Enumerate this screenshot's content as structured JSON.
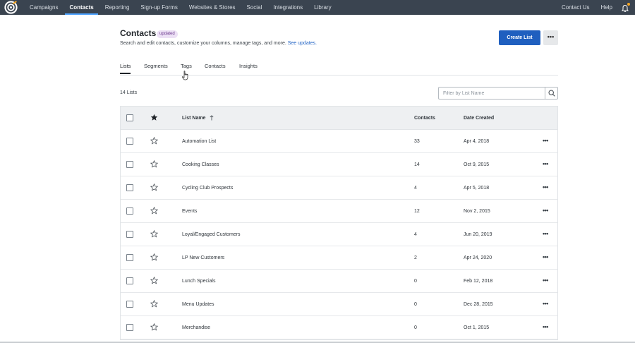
{
  "nav": {
    "items": [
      {
        "label": "Campaigns",
        "active": false
      },
      {
        "label": "Contacts",
        "active": true
      },
      {
        "label": "Reporting",
        "active": false
      },
      {
        "label": "Sign-up Forms",
        "active": false
      },
      {
        "label": "Websites & Stores",
        "active": false
      },
      {
        "label": "Social",
        "active": false
      },
      {
        "label": "Integrations",
        "active": false
      },
      {
        "label": "Library",
        "active": false
      }
    ],
    "contact_us": "Contact Us",
    "help": "Help",
    "notification_icon": "bell-icon",
    "brand_color": "#3a4450",
    "accent_color": "#f5a623"
  },
  "header": {
    "title": "Contacts",
    "badge": "updated",
    "subtitle": "Search and edit contacts, customize your columns, manage tags, and more.",
    "subtitle_link": "See updates.",
    "create_button": "Create List",
    "more_button": "•••",
    "primary_color": "#1f5fbf"
  },
  "tabs": [
    {
      "label": "Lists",
      "active": true
    },
    {
      "label": "Segments",
      "active": false
    },
    {
      "label": "Tags",
      "active": false
    },
    {
      "label": "Contacts",
      "active": false
    },
    {
      "label": "Insights",
      "active": false
    }
  ],
  "list_count": "14 Lists",
  "filter": {
    "placeholder": "Filter by List Name",
    "icon": "search-icon"
  },
  "table": {
    "columns": {
      "name": "List Name",
      "contacts": "Contacts",
      "date": "Date Created"
    },
    "rows": [
      {
        "name": "Automation List",
        "contacts": "33",
        "date": "Apr 4, 2018"
      },
      {
        "name": "Cooking Classes",
        "contacts": "14",
        "date": "Oct 9, 2015"
      },
      {
        "name": "Cycling Club Prospects",
        "contacts": "4",
        "date": "Apr 5, 2018"
      },
      {
        "name": "Events",
        "contacts": "12",
        "date": "Nov 2, 2015"
      },
      {
        "name": "Loyal/Engaged Customers",
        "contacts": "4",
        "date": "Jun 20, 2019"
      },
      {
        "name": "LP New Customers",
        "contacts": "2",
        "date": "Apr 24, 2020"
      },
      {
        "name": "Lunch Specials",
        "contacts": "0",
        "date": "Feb 12, 2018"
      },
      {
        "name": "Menu Updates",
        "contacts": "0",
        "date": "Dec 28, 2015"
      },
      {
        "name": "Merchandise",
        "contacts": "0",
        "date": "Oct 1, 2015"
      }
    ],
    "row_menu": "•••"
  }
}
